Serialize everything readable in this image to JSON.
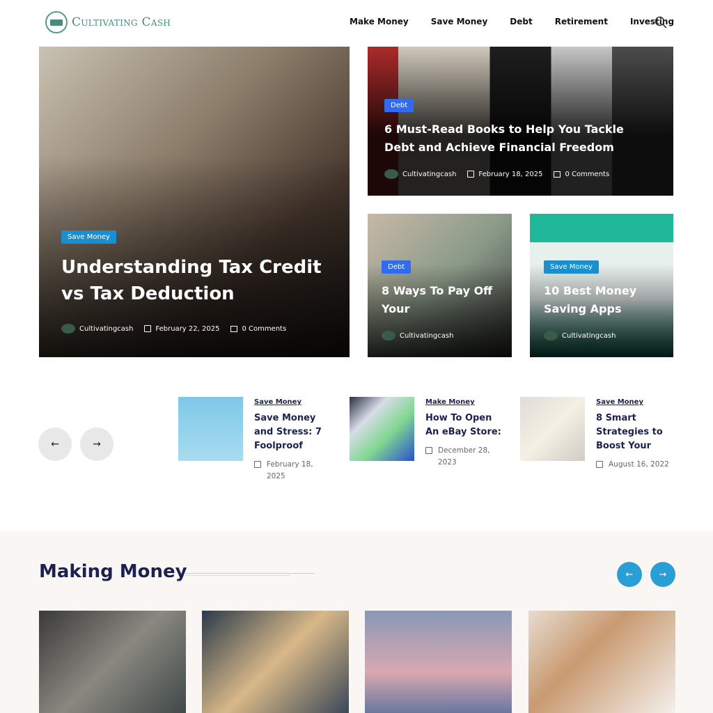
{
  "header": {
    "logo_text": "Cultivating Cash",
    "nav": [
      "Make Money",
      "Save Money",
      "Debt",
      "Retirement",
      "Investing"
    ],
    "search_icon": "search-icon"
  },
  "hero": {
    "category": "Save Money",
    "title": "Understanding Tax Credit vs Tax Deduction",
    "author": "Cultivatingcash",
    "date": "February 22, 2025",
    "comments": "0 Comments"
  },
  "top_right": {
    "category": "Debt",
    "title": "6 Must-Read Books to Help You Tackle Debt and Achieve Financial Freedom",
    "author": "Cultivatingcash",
    "date": "February 18, 2025",
    "comments": "0 Comments"
  },
  "small_cards": [
    {
      "category": "Debt",
      "title": "8 Ways To Pay Off Your",
      "author": "Cultivatingcash"
    },
    {
      "category": "Save Money",
      "title": "10 Best Money Saving Apps",
      "author": "Cultivatingcash"
    }
  ],
  "slider": {
    "prev_icon": "arrow-left-icon",
    "next_icon": "arrow-right-icon",
    "posts": [
      {
        "category": "Save Money",
        "title": "Save Money and Stress: 7 Foolproof",
        "date": "February 18, 2025"
      },
      {
        "category": "Make Money",
        "title": "How To Open An eBay Store:",
        "date": "December 28, 2023"
      },
      {
        "category": "Save Money",
        "title": "8 Smart Strategies to Boost Your",
        "date": "August 16, 2022"
      }
    ]
  },
  "making_money": {
    "title": "Making Money"
  },
  "colors": {
    "brand": "#4a8a78",
    "navy": "#1b2250",
    "badge_save": "#1a8fd0",
    "badge_debt": "#2f6cf0",
    "accent_blue": "#2a9fd6"
  }
}
